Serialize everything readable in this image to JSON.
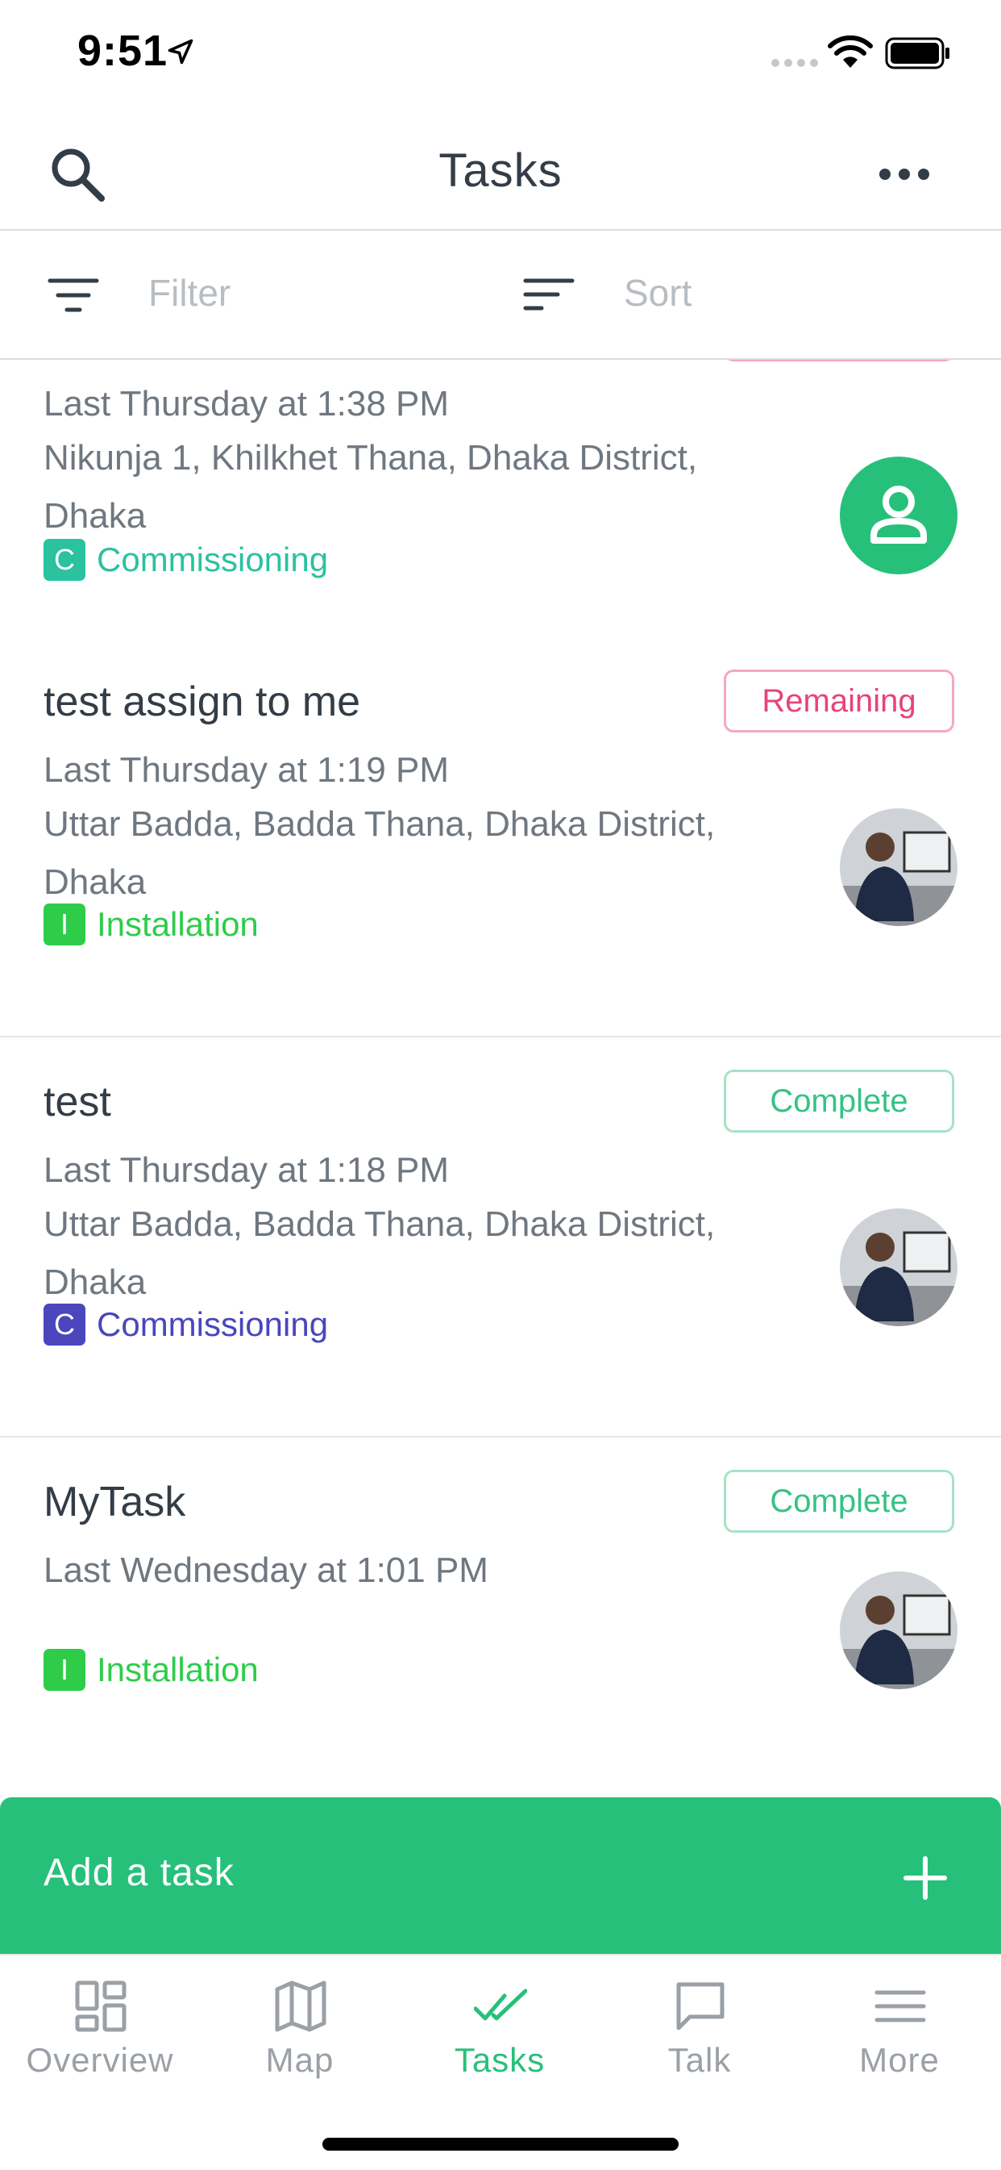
{
  "status_bar": {
    "time": "9:51"
  },
  "header": {
    "title": "Tasks"
  },
  "toolbar": {
    "filter_label": "Filter",
    "sort_label": "Sort"
  },
  "tasks": [
    {
      "title": "",
      "time": "Last Thursday at 1:38 PM",
      "address": "Nikunja 1, Khilkhet Thana, Dhaka District, Dhaka",
      "type_letter": "C",
      "type_label": "Commissioning",
      "type_color": "#2bc2a0",
      "status": "",
      "status_color": "#e8427a",
      "avatar": "person-placeholder"
    },
    {
      "title": "test assign to me",
      "time": "Last Thursday at 1:19 PM",
      "address": "Uttar Badda, Badda Thana, Dhaka District, Dhaka",
      "type_letter": "I",
      "type_label": "Installation",
      "type_color": "#2fcc4a",
      "status": "Remaining",
      "status_color": "#e8427a",
      "avatar": "user-photo"
    },
    {
      "title": "test",
      "time": "Last Thursday at 1:18 PM",
      "address": "Uttar Badda, Badda Thana, Dhaka District, Dhaka",
      "type_letter": "C",
      "type_label": "Commissioning",
      "type_color": "#4a46bd",
      "status": "Complete",
      "status_color": "#34c384",
      "avatar": "user-photo"
    },
    {
      "title": "MyTask",
      "time": "Last Wednesday at 1:01 PM",
      "address": "",
      "type_letter": "I",
      "type_label": "Installation",
      "type_color": "#2fcc4a",
      "status": "Complete",
      "status_color": "#34c384",
      "avatar": "user-photo"
    }
  ],
  "add_task": {
    "label": "Add a task"
  },
  "tab_bar": {
    "tabs": [
      {
        "label": "Overview",
        "icon": "overview-icon"
      },
      {
        "label": "Map",
        "icon": "map-icon"
      },
      {
        "label": "Tasks",
        "icon": "tasks-icon",
        "active": true
      },
      {
        "label": "Talk",
        "icon": "talk-icon"
      },
      {
        "label": "More",
        "icon": "more-icon"
      }
    ]
  },
  "colors": {
    "accent": "#27c07a",
    "text": "#333d47",
    "muted": "#6f7780"
  }
}
